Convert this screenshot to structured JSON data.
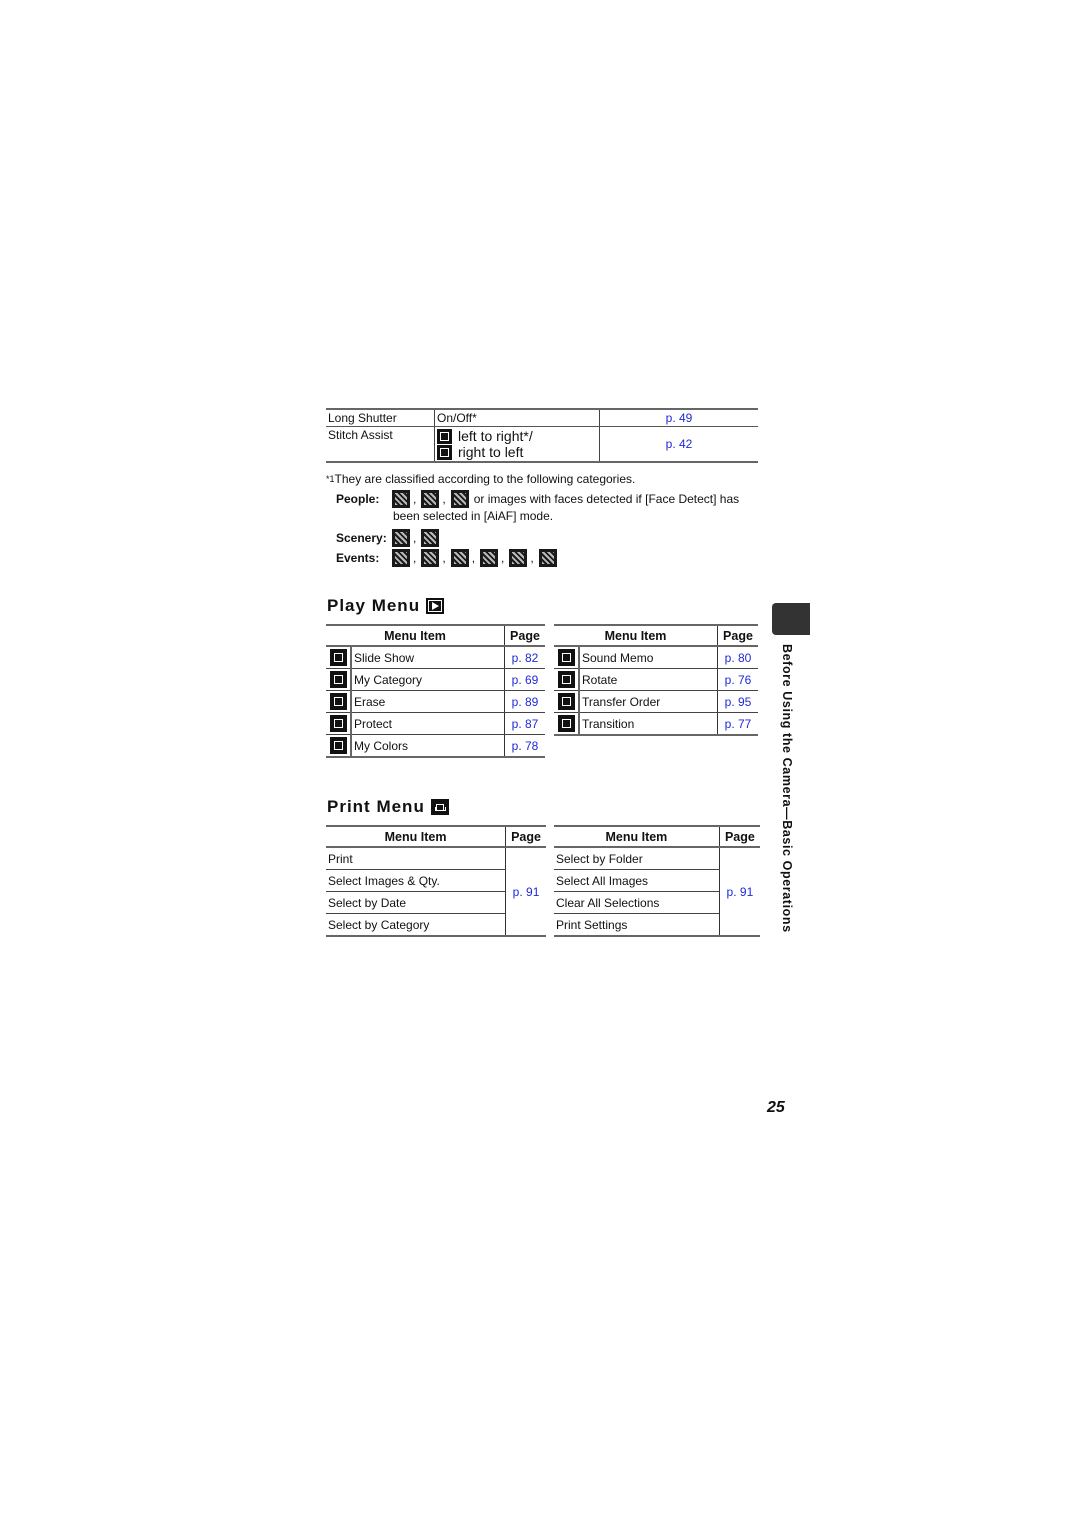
{
  "top_table": {
    "rows": [
      {
        "item": "Long Shutter",
        "setting": "On/Off*",
        "page": "p. 49"
      },
      {
        "item": "Stitch Assist",
        "setting_lines": [
          "left to right*/",
          "right to left"
        ],
        "setting_icons": [
          "stitch-left-to-right-icon",
          "stitch-right-to-left-icon"
        ],
        "page": "p. 42"
      }
    ]
  },
  "footnote": {
    "marker": "*1",
    "text": "They are classified according to the following categories.",
    "categories": [
      {
        "label": "People:",
        "icons": [
          "portrait-icon",
          "kids-and-pets-icon",
          "pets-icon"
        ],
        "trailing": " or images with faces detected if [Face Detect] has",
        "continuation": "been selected in [AiAF] mode."
      },
      {
        "label": "Scenery:",
        "icons": [
          "landscape-icon",
          "foliage-icon"
        ]
      },
      {
        "label": "Events:",
        "icons": [
          "party-icon",
          "snow-icon",
          "beach-icon",
          "fireworks-icon",
          "aquarium-icon",
          "underwater-icon"
        ]
      }
    ]
  },
  "play_menu": {
    "title": "Play Menu",
    "header": {
      "item": "Menu Item",
      "page": "Page"
    },
    "left": [
      {
        "icon": "slide-show-icon",
        "label": "Slide Show",
        "page": "p. 82"
      },
      {
        "icon": "my-category-icon",
        "label": "My Category",
        "page": "p. 69"
      },
      {
        "icon": "erase-icon",
        "label": "Erase",
        "page": "p. 89"
      },
      {
        "icon": "protect-key-icon",
        "label": "Protect",
        "page": "p. 87"
      },
      {
        "icon": "my-colors-icon",
        "label": "My Colors",
        "page": "p. 78"
      }
    ],
    "right": [
      {
        "icon": "sound-memo-icon",
        "label": "Sound Memo",
        "page": "p. 80"
      },
      {
        "icon": "rotate-icon",
        "label": "Rotate",
        "page": "p. 76"
      },
      {
        "icon": "transfer-order-icon",
        "label": "Transfer Order",
        "page": "p. 95"
      },
      {
        "icon": "transition-icon",
        "label": "Transition",
        "page": "p. 77"
      }
    ]
  },
  "print_menu": {
    "title": "Print Menu",
    "header": {
      "item": "Menu Item",
      "page": "Page"
    },
    "left": [
      "Print",
      "Select Images & Qty.",
      "Select by Date",
      "Select by Category"
    ],
    "left_page": "p. 91",
    "right": [
      "Select by Folder",
      "Select All Images",
      "Clear All Selections",
      "Print Settings"
    ],
    "right_page": "p. 91"
  },
  "side_tab": {
    "text": "Before Using the Camera—Basic Operations"
  },
  "page_number": "25",
  "colors": {
    "link": "#1f2ad6",
    "tab": "#333333"
  }
}
